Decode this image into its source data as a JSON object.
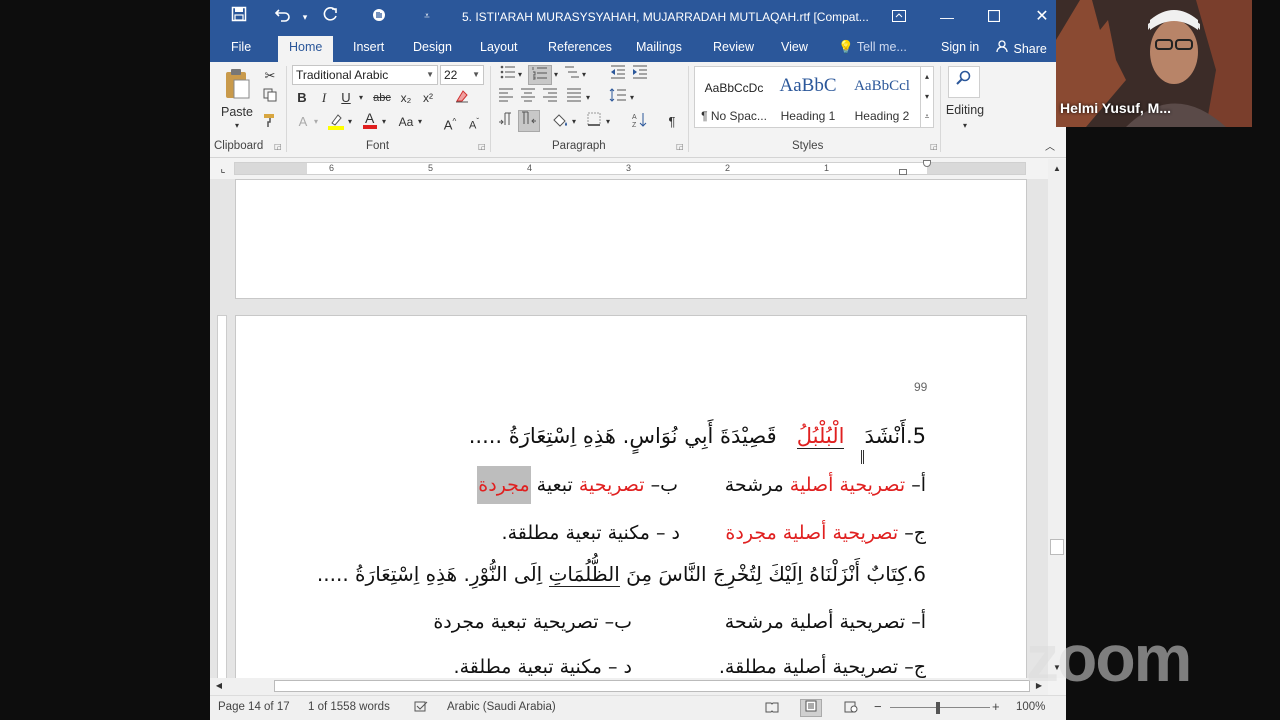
{
  "titlebar": {
    "doc_title": "5. ISTI'ARAH MURASYSYAHAH, MUJARRADAH MUTLAQAH.rtf [Compat...",
    "icons": [
      "save-icon",
      "undo-icon",
      "redo-icon",
      "touch-mode-icon",
      "customize-qat-icon",
      "ribbon-display-icon",
      "minimize-icon",
      "maximize-icon",
      "close-icon"
    ]
  },
  "tabs": {
    "file": "File",
    "home": "Home",
    "insert": "Insert",
    "design": "Design",
    "layout": "Layout",
    "references": "References",
    "mailings": "Mailings",
    "review": "Review",
    "view": "View",
    "tell_me": "Tell me...",
    "sign_in": "Sign in",
    "share": "Share"
  },
  "ribbon": {
    "clipboard": {
      "paste": "Paste",
      "label": "Clipboard"
    },
    "font": {
      "font_name": "Traditional Arabic",
      "font_size": "22",
      "label": "Font",
      "bold": "B",
      "italic": "I",
      "underline": "U",
      "strike": "abc",
      "subscript": "x₂",
      "superscript": "x²",
      "change_case": "Aa",
      "grow": "A",
      "shrink": "A"
    },
    "paragraph": {
      "label": "Paragraph",
      "pilcrow": "¶"
    },
    "styles": {
      "label": "Styles",
      "items": [
        {
          "preview": "AaBbCcDc",
          "name": "¶ No Spac..."
        },
        {
          "preview": "AaBbC",
          "name": "Heading 1"
        },
        {
          "preview": "AaBbCcl",
          "name": "Heading 2"
        }
      ]
    },
    "editing": {
      "label": "Editing"
    }
  },
  "ruler": {
    "numbers": [
      "6",
      "5",
      "4",
      "3",
      "2",
      "1"
    ]
  },
  "document": {
    "page_number": "99",
    "q5": {
      "num": "5.",
      "w1": "أَنْشَدَ",
      "w2": "الْبُلْبُلُ",
      "w3": "قَصِيْدَةَ أَبِي نُوَاسٍ. هَذِهِ اِسْتِعَارَةُ .....",
      "opt_a_label": "أ–",
      "opt_a_red": "تصريحية أصلية",
      "opt_a_rest": "مرشحة",
      "opt_b_label": "ب–",
      "opt_b_red1": "تصريحية",
      "opt_b_mid": "تبعية",
      "opt_b_red2": "مجردة",
      "opt_c_label": "ج–",
      "opt_c_red": "تصريحية أصلية مجردة",
      "opt_d": "د – مكنية تبعية مطلقة."
    },
    "q6": {
      "line_pre": "6.كِتَابٌ أَنْزَلْنَاهُ اِلَيْكَ لِتُخْرِجَ النَّاسَ مِنَ",
      "underlined": "الظُّلُمَاتِ",
      "line_post": "اِلَى النُّوْرِ. هَذِهِ اِسْتِعَارَةُ .....",
      "opt_a": "أ– تصريحية أصلية مرشحة",
      "opt_b": "ب– تصريحية تبعية مجردة",
      "opt_c": "ج– تصريحية أصلية مطلقة.",
      "opt_d": "د – مكنية تبعية مطلقة."
    }
  },
  "statusbar": {
    "page": "Page 14 of 17",
    "words": "1 of 1558 words",
    "language": "Arabic (Saudi Arabia)",
    "zoom": "100%"
  },
  "overlay": {
    "participant_name": "Helmi Yusuf, M...",
    "watermark": "zoom"
  },
  "colors": {
    "word_blue": "#2b579a",
    "red_text": "#e02020",
    "highlight": "#bdbdbd"
  }
}
